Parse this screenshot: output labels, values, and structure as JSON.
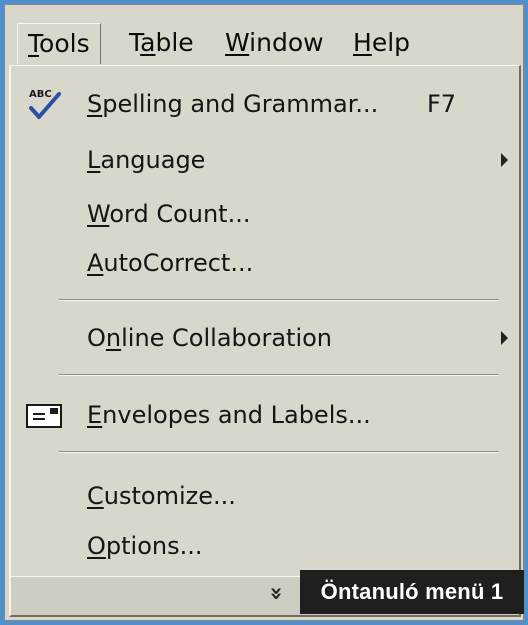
{
  "menubar": {
    "items": [
      {
        "name": "menubar-tools",
        "label": "Tools",
        "mnemonic": "T",
        "rest": "ools"
      },
      {
        "name": "menubar-table",
        "pre": "T",
        "mnemonic": "a",
        "rest": "ble"
      },
      {
        "name": "menubar-window",
        "pre": "",
        "mnemonic": "W",
        "rest": "indow"
      },
      {
        "name": "menubar-help",
        "pre": "",
        "mnemonic": "H",
        "rest": "elp"
      }
    ]
  },
  "menu": {
    "items": [
      {
        "pre": "",
        "mnemonic": "S",
        "rest": "pelling and Grammar...",
        "shortcut": "F7",
        "icon": "spelling-abc-check-icon"
      },
      {
        "pre": "",
        "mnemonic": "L",
        "rest": "anguage",
        "submenu": true
      },
      {
        "pre": "",
        "mnemonic": "W",
        "rest": "ord Count..."
      },
      {
        "pre": "",
        "mnemonic": "A",
        "rest": "utoCorrect..."
      },
      {
        "pre": "O",
        "mnemonic": "n",
        "rest": "line Collaboration",
        "submenu": true
      },
      {
        "pre": "",
        "mnemonic": "E",
        "rest": "nvelopes and Labels...",
        "icon": "envelope-icon"
      },
      {
        "pre": "",
        "mnemonic": "C",
        "rest": "ustomize..."
      },
      {
        "pre": "",
        "mnemonic": "O",
        "rest": "ptions..."
      }
    ],
    "expand_icon": "double-chevron-down-icon"
  },
  "caption": "Öntanuló menü 1",
  "colors": {
    "menu_bg": "#d9d6cc",
    "page_bg": "#4f8fcb",
    "caption_bg": "#1f1f1f"
  }
}
